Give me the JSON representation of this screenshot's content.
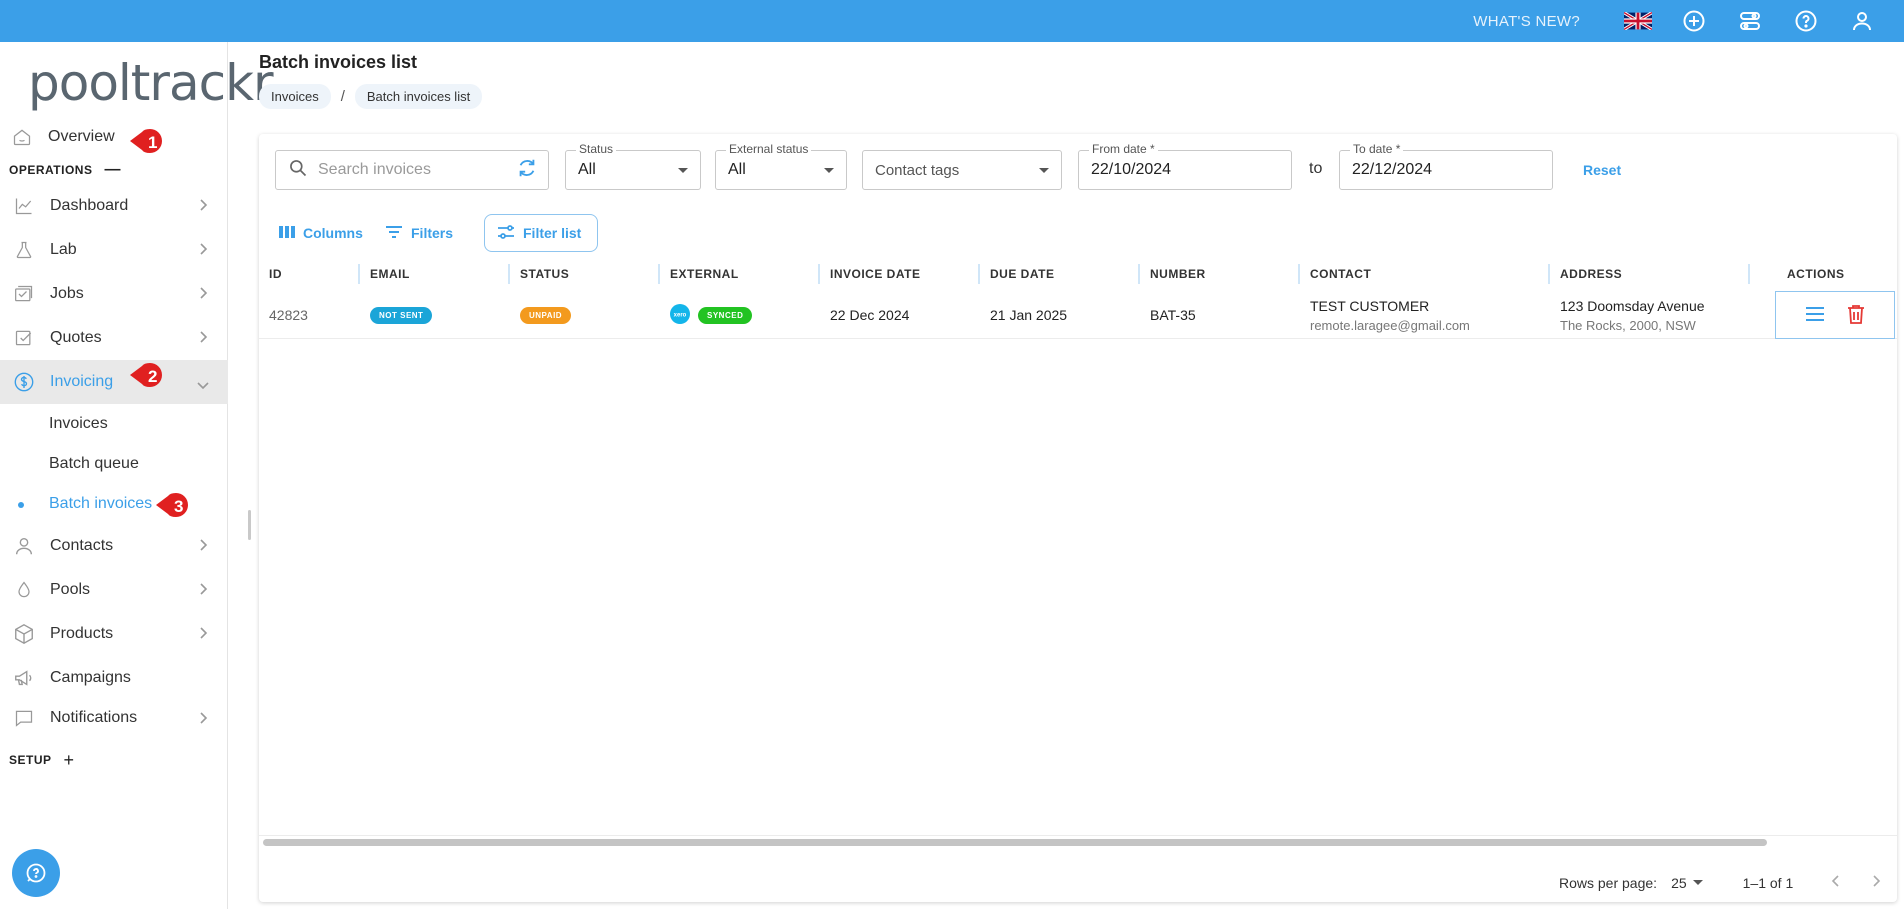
{
  "topbar": {
    "whats_new": "WHAT'S NEW?"
  },
  "brand": {
    "logo_text": "pooltrackr"
  },
  "sidebar": {
    "overview": "Overview",
    "operations_label": "OPERATIONS",
    "items": [
      {
        "label": "Dashboard"
      },
      {
        "label": "Lab"
      },
      {
        "label": "Jobs"
      },
      {
        "label": "Quotes"
      },
      {
        "label": "Invoicing"
      }
    ],
    "invoicing_sub": [
      {
        "label": "Invoices"
      },
      {
        "label": "Batch queue"
      },
      {
        "label": "Batch invoices"
      }
    ],
    "items_after": [
      {
        "label": "Contacts"
      },
      {
        "label": "Pools"
      },
      {
        "label": "Products"
      },
      {
        "label": "Campaigns"
      },
      {
        "label": "Notifications"
      }
    ],
    "setup_label": "SETUP",
    "badges": [
      "1",
      "2",
      "3"
    ]
  },
  "page": {
    "title": "Batch invoices list",
    "breadcrumb": [
      "Invoices",
      "Batch invoices list"
    ]
  },
  "filters": {
    "search_placeholder": "Search invoices",
    "status": {
      "label": "Status",
      "value": "All"
    },
    "external_status": {
      "label": "External status",
      "value": "All"
    },
    "contact_tags": {
      "placeholder": "Contact tags"
    },
    "from_date": {
      "label": "From date *",
      "value": "22/10/2024"
    },
    "to_word": "to",
    "to_date": {
      "label": "To date *",
      "value": "22/12/2024"
    },
    "reset": "Reset"
  },
  "toolbar": {
    "columns": "Columns",
    "filters": "Filters",
    "filter_list": "Filter list"
  },
  "table": {
    "headers": [
      "ID",
      "EMAIL",
      "STATUS",
      "EXTERNAL",
      "INVOICE DATE",
      "DUE DATE",
      "NUMBER",
      "CONTACT",
      "ADDRESS",
      "ACTIONS"
    ],
    "rows": [
      {
        "id": "42823",
        "email": "NOT SENT",
        "status": "UNPAID",
        "external_logo": "xero",
        "external": "SYNCED",
        "invoice_date": "22 Dec 2024",
        "due_date": "21 Jan 2025",
        "number": "BAT-35",
        "contact_name": "TEST CUSTOMER",
        "contact_email": "remote.laragee@gmail.com",
        "address_line1": "123 Doomsday Avenue",
        "address_line2": "The Rocks, 2000, NSW"
      }
    ]
  },
  "pagination": {
    "rows_per_page_label": "Rows per page:",
    "rows_per_page": "25",
    "range": "1–1 of 1"
  },
  "colors": {
    "accent": "#3b9fe8",
    "not_sent": "#1ba5d8",
    "unpaid": "#f39a1e",
    "synced": "#22c322",
    "badge": "#e02020",
    "delete": "#e53935"
  }
}
